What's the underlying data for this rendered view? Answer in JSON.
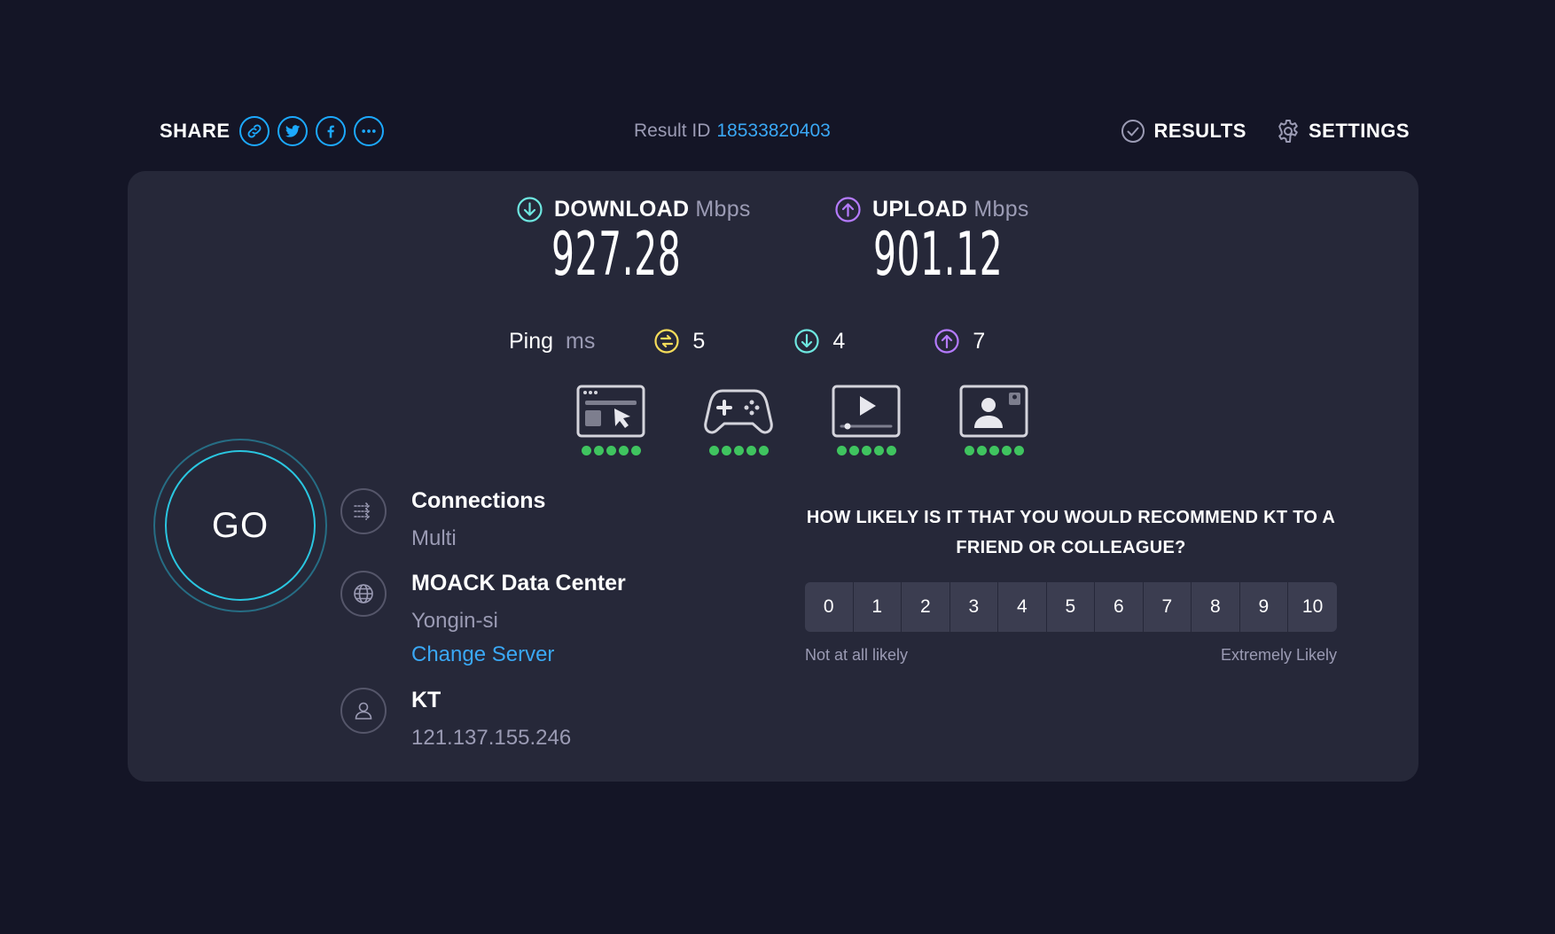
{
  "share": {
    "label": "SHARE",
    "buttons": [
      "link-icon",
      "twitter-icon",
      "facebook-icon",
      "more-icon"
    ]
  },
  "result": {
    "label": "Result ID",
    "id": "18533820403"
  },
  "nav": {
    "results": "RESULTS",
    "settings": "SETTINGS"
  },
  "download": {
    "label": "DOWNLOAD",
    "unit": "Mbps",
    "value": "927.28"
  },
  "upload": {
    "label": "UPLOAD",
    "unit": "Mbps",
    "value": "901.12"
  },
  "ping": {
    "label": "Ping",
    "unit": "ms",
    "idle": "5",
    "download": "4",
    "upload": "7"
  },
  "categories": [
    {
      "icon": "web-browsing-icon",
      "rating": 5
    },
    {
      "icon": "gaming-icon",
      "rating": 5
    },
    {
      "icon": "video-streaming-icon",
      "rating": 5
    },
    {
      "icon": "video-chat-icon",
      "rating": 5
    }
  ],
  "go": {
    "label": "GO"
  },
  "connections": {
    "title": "Connections",
    "value": "Multi"
  },
  "server": {
    "title": "MOACK Data Center",
    "location": "Yongin-si",
    "change": "Change Server"
  },
  "provider": {
    "title": "KT",
    "ip": "121.137.155.246"
  },
  "survey": {
    "question": "HOW LIKELY IS IT THAT YOU WOULD RECOMMEND KT TO A FRIEND OR COLLEAGUE?",
    "scale": [
      "0",
      "1",
      "2",
      "3",
      "4",
      "5",
      "6",
      "7",
      "8",
      "9",
      "10"
    ],
    "low_label": "Not at all likely",
    "high_label": "Extremely Likely"
  },
  "colors": {
    "background": "#141526",
    "panel": "#262839",
    "accent_blue": "#1ca9ff",
    "download": "#6ee7e0",
    "upload": "#b57bff",
    "ping": "#f5dc5a",
    "rating_dot": "#3fc45f"
  }
}
